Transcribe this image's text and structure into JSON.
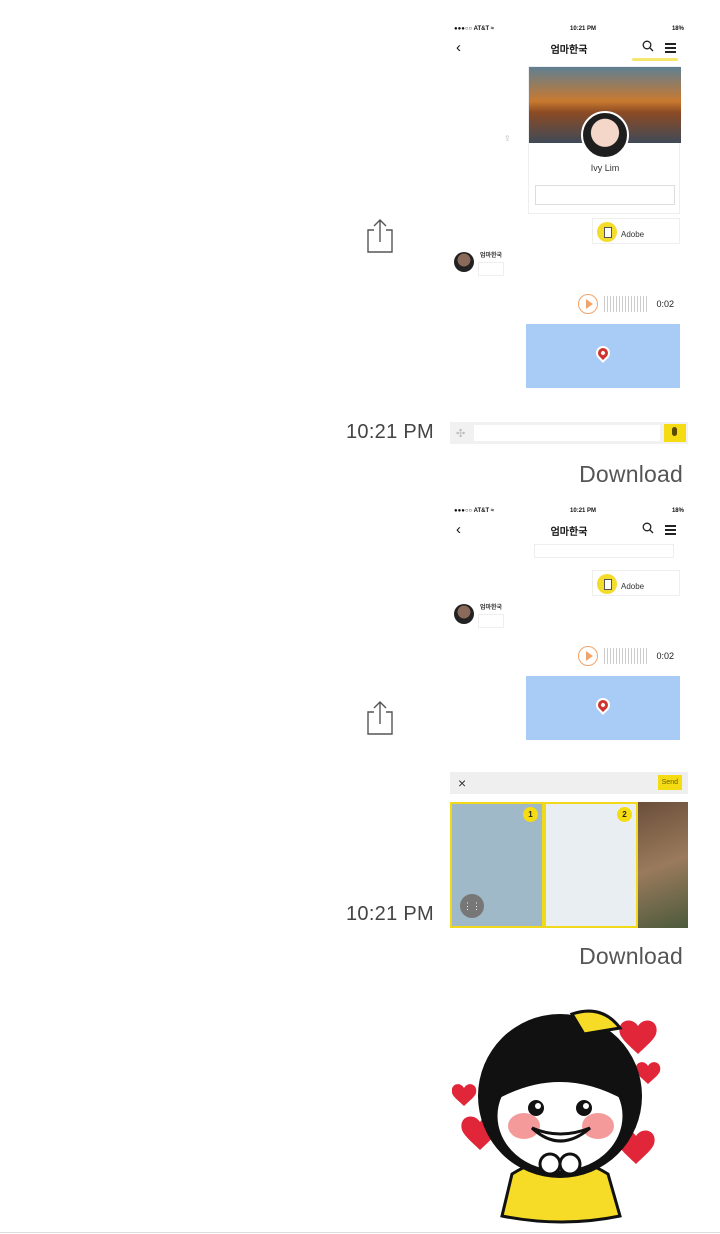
{
  "messages": [
    {
      "time": "10:21 PM",
      "download_label": "Download",
      "screenshot": {
        "status": {
          "carrier": "●●●○○ AT&T ≈",
          "clock": "10:21 PM",
          "battery": "18%"
        },
        "chat_title": "엄마한국",
        "profile_name": "Ivy Lim",
        "file_name": "Adobe",
        "sender_name": "엄마한국",
        "voice_duration": "0:02"
      }
    },
    {
      "time": "10:21 PM",
      "download_label": "Download",
      "screenshot": {
        "status": {
          "carrier": "●●●○○ AT&T ≈",
          "clock": "10:21 PM",
          "battery": "18%"
        },
        "chat_title": "엄마한국",
        "file_name": "Adobe",
        "sender_name": "엄마한국",
        "voice_duration": "0:02",
        "picker_send": "Send",
        "thumb_1": "1",
        "thumb_2": "2"
      }
    }
  ],
  "sticker": {
    "description_icon": "girl-with-hearts-sticker"
  },
  "colors": {
    "accent_yellow": "#f5dc12",
    "map_blue": "#a9ccf7",
    "pin_red": "#d0342c"
  }
}
